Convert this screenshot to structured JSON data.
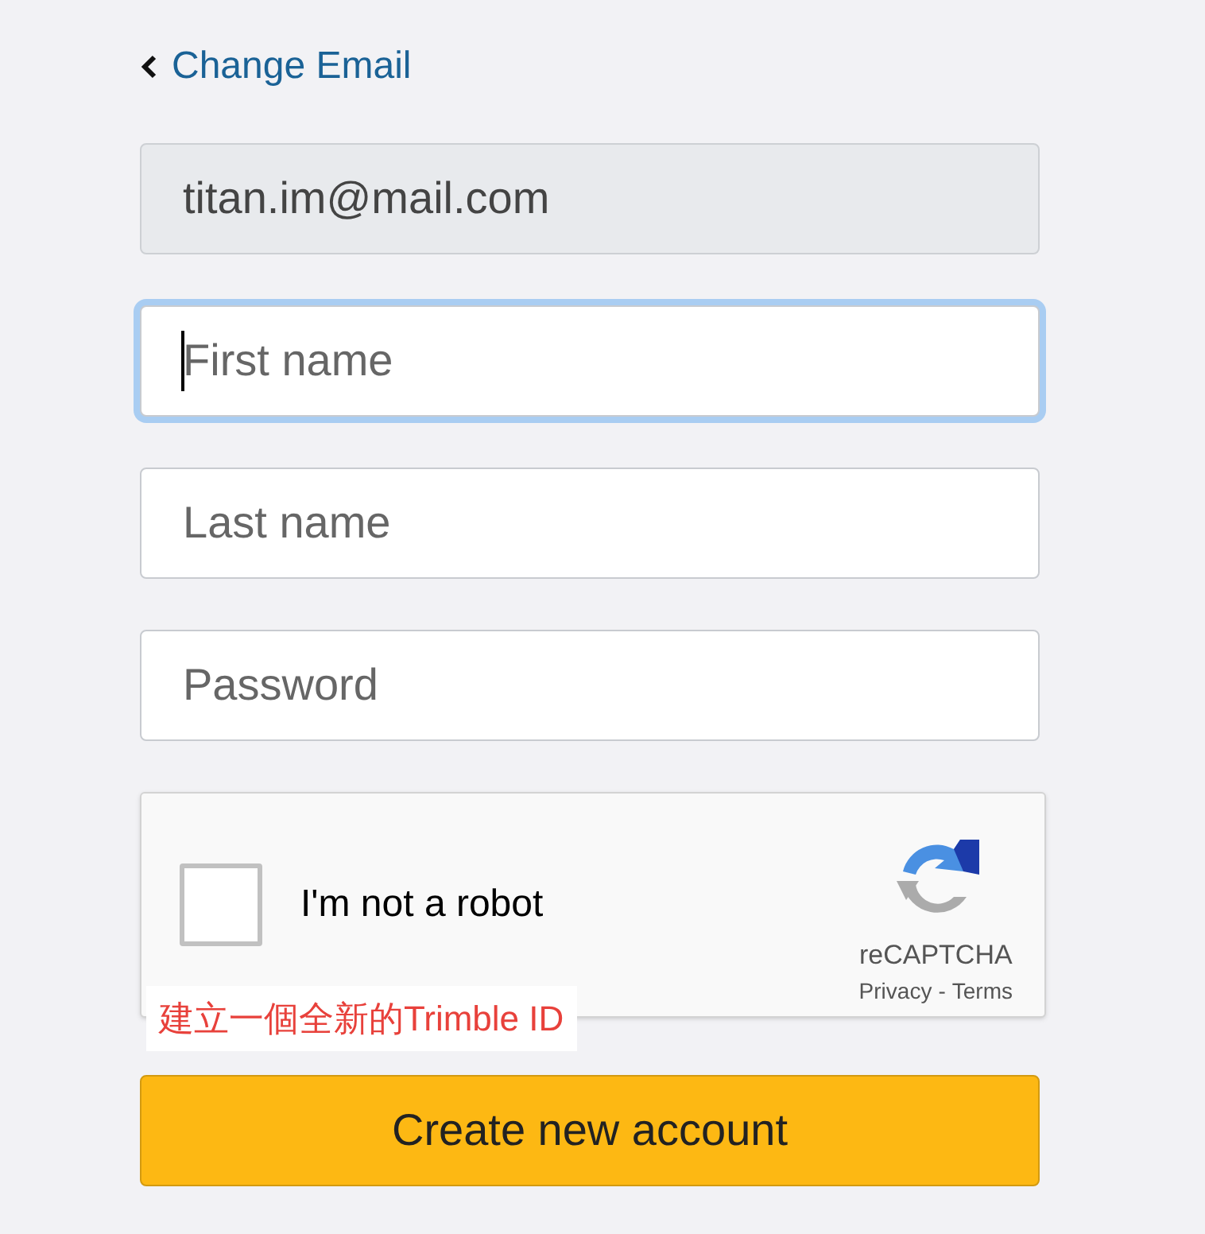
{
  "back_link": {
    "label": "Change Email"
  },
  "fields": [
    {
      "value": "titan.im@mail.com",
      "disabled": true,
      "focused": false
    },
    {
      "placeholder": "First name",
      "disabled": false,
      "focused": true
    },
    {
      "placeholder": "Last name",
      "disabled": false,
      "focused": false
    },
    {
      "placeholder": "Password",
      "disabled": false,
      "focused": false
    }
  ],
  "captcha": {
    "label": "I'm not a robot",
    "checked": false,
    "brand": "reCAPTCHA",
    "privacy": "Privacy",
    "separator": "-",
    "terms": "Terms"
  },
  "annotation": "建立一個全新的Trimble ID",
  "submit_button": {
    "label": "Create new account"
  }
}
